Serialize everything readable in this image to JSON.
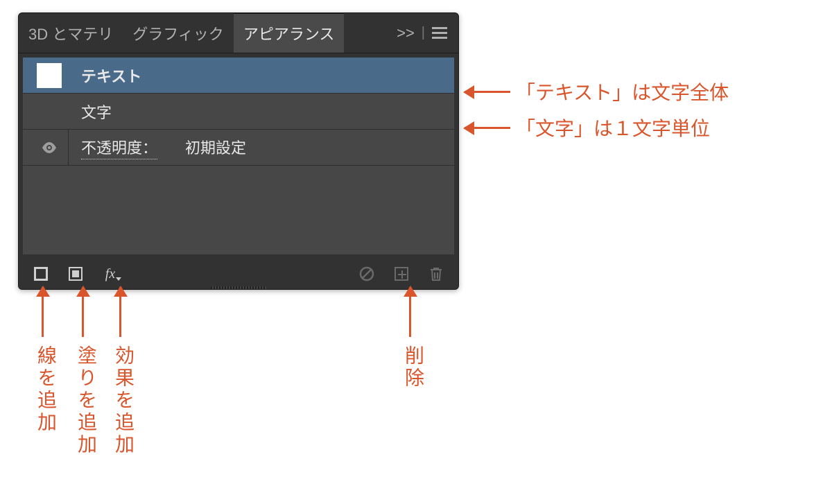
{
  "tabs": {
    "t1": "3D とマテリ",
    "t2": "グラフィック",
    "t3": "アピアランス",
    "overflow": ">>"
  },
  "rows": {
    "textRow": "テキスト",
    "charRow": "文字",
    "opacityLabel": "不透明度：",
    "opacityValue": "初期設定"
  },
  "annot": {
    "textNote": "「テキスト」は文字全体",
    "charNote": "「文字」は１文字単位",
    "stroke": "線を追加",
    "fill": "塗りを追加",
    "effect": "効果を追加",
    "delete": "削除"
  }
}
